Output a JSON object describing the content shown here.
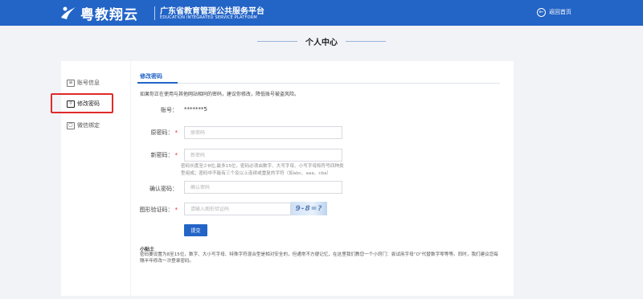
{
  "header": {
    "brand": "粤教翔云",
    "platform_cn": "广东省教育管理公共服务平台",
    "platform_en": "EDUCATION INTEGRATED SERVICE PLATFORM",
    "back_home": "返回首页",
    "background": "#2364c7"
  },
  "page": {
    "title": "个人中心"
  },
  "sidebar": {
    "items": [
      {
        "label": "账号信息",
        "icon": "account-card-icon",
        "active": false
      },
      {
        "label": "修改密码",
        "icon": "password-user-icon",
        "active": true
      },
      {
        "label": "微信绑定",
        "icon": "wechat-bind-icon",
        "active": false
      }
    ],
    "highlight_color": "#e02a2a"
  },
  "form": {
    "section_title": "修改密码",
    "notice": "如果你正在使用与其他网站相同的密码，建议你修改，降低账号被盗风险。",
    "account_label": "账号：",
    "account_value": "*******5",
    "old_password_label": "原密码：",
    "old_password_placeholder": "原密码",
    "new_password_label": "新密码：",
    "new_password_placeholder": "新密码",
    "password_hint": "密码长度至少8位,最多15位，密码必须由数字、大写字母、小写字母和符号四种类型组成；密码中不能有三个及以上连续或重复的字符（如abc、aaa、cba）",
    "confirm_label": "确认密码：",
    "confirm_placeholder": "确认密码",
    "captcha_label": "图形验证码：",
    "captcha_placeholder": "请输入图形验证码",
    "captcha_text": "9-8=?",
    "required_mark": "*",
    "submit_label": "提交",
    "accent": "#2364c7"
  },
  "tips": {
    "title": "小贴士",
    "body": "密码要设置为8至15位，数字、大小写字母、特殊字符混合型是相对安全的，但通常不方便记忆，在这里我们教您一个小窍门：尝试用字母“O”代替数字零等等。同时，我们建议您每隔半年修改一次登录密码。"
  }
}
